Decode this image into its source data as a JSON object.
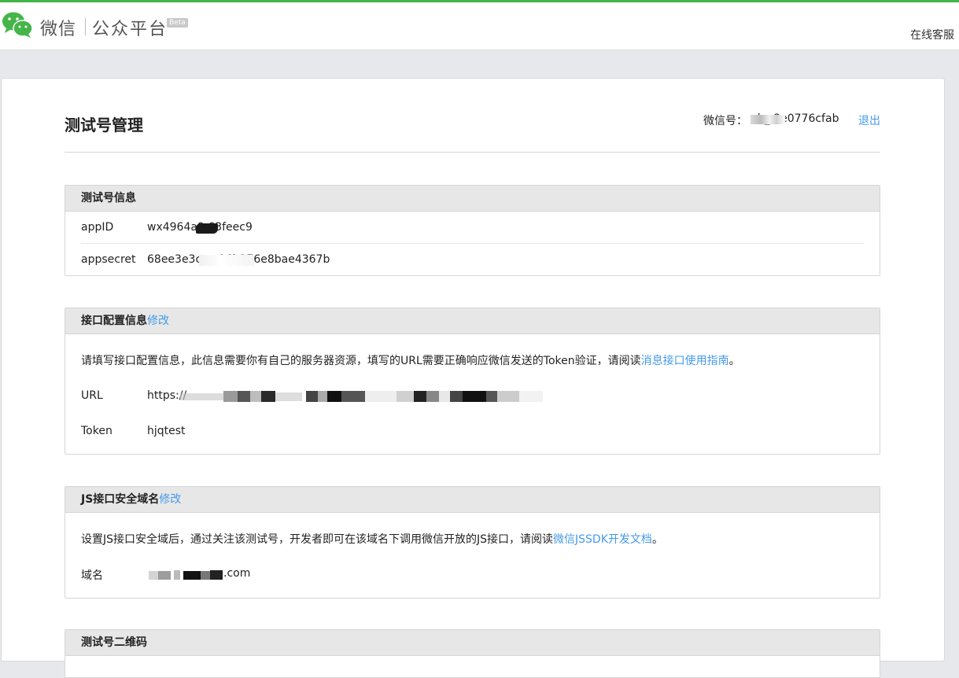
{
  "header": {
    "logo_icon": "wechat-logo-icon",
    "brand_weixin": "微信",
    "brand_platform": "公众平台",
    "beta_badge": "Beta",
    "support_link": "在线客服"
  },
  "page": {
    "title": "测试号管理",
    "account_label": "微信号：",
    "account_value": "gh_  3e0776cfab",
    "logout": "退出"
  },
  "test_account_info": {
    "title": "测试号信息",
    "appid_label": "appID",
    "appid_value": "wx4964a9   63feec9",
    "appsecret_label": "appsecret",
    "appsecret_value": "68ee3e3ca    e96b276e8bae4367b"
  },
  "interface_config": {
    "title": "接口配置信息",
    "edit_link": "修改",
    "description": "请填写接口配置信息，此信息需要你有自己的服务器资源，填写的URL需要正确响应微信发送的Token验证，请阅读",
    "guide_link": "消息接口使用指南",
    "period": "。",
    "url_label": "URL",
    "url_value": "https://",
    "token_label": "Token",
    "token_value": "hjqtest"
  },
  "js_domain": {
    "title": "JS接口安全域名",
    "edit_link": "修改",
    "description": "设置JS接口安全域后，通过关注该测试号，开发者即可在该域名下调用微信开放的JS接口，请阅读",
    "doc_link": "微信JSSDK开发文档",
    "period": "。",
    "domain_label": "域名",
    "domain_value": ".com"
  },
  "qrcode": {
    "title": "测试号二维码"
  },
  "colors": {
    "accent_green": "#44b549",
    "link_blue": "#459ae9"
  }
}
